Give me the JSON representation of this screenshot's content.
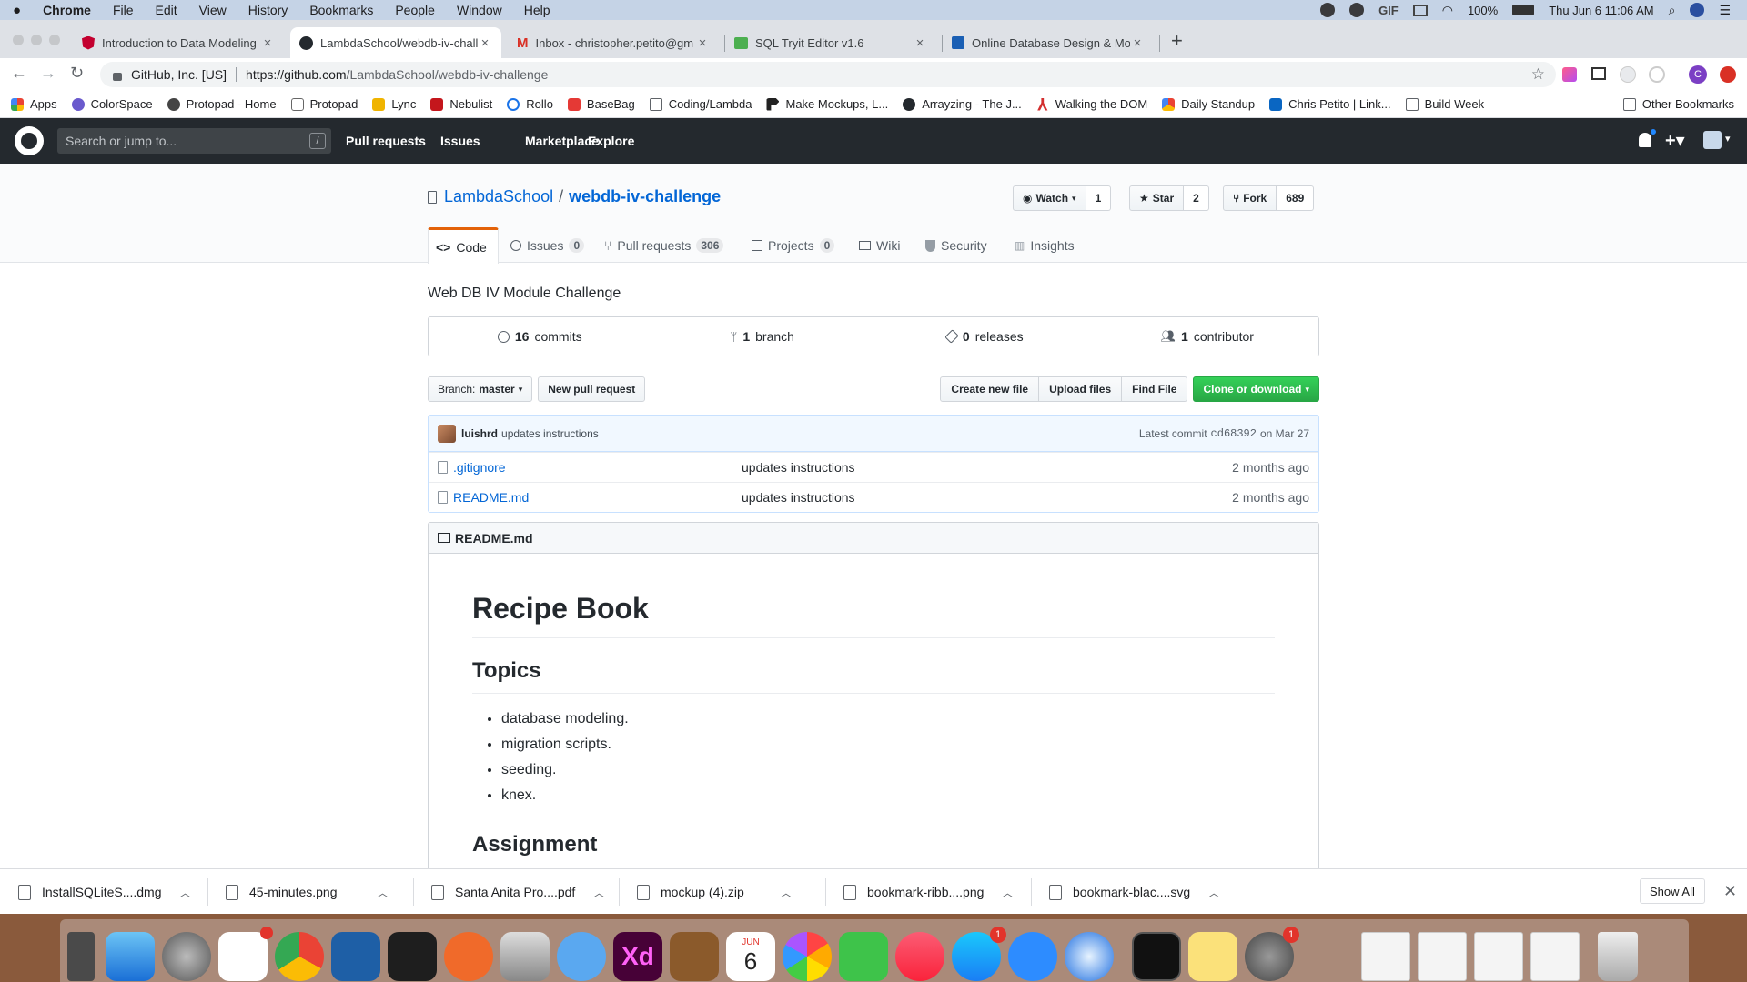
{
  "menubar": {
    "app": "Chrome",
    "items": [
      "File",
      "Edit",
      "View",
      "History",
      "Bookmarks",
      "People",
      "Window",
      "Help"
    ],
    "battery": "100%",
    "datetime": "Thu Jun 6  11:06 AM"
  },
  "tabs": [
    {
      "title": "Introduction to Data Modeling",
      "active": false
    },
    {
      "title": "LambdaSchool/webdb-iv-chall",
      "active": true
    },
    {
      "title": "Inbox - christopher.petito@gm",
      "active": false
    },
    {
      "title": "SQL Tryit Editor v1.6",
      "active": false
    },
    {
      "title": "Online Database Design & Mod",
      "active": false
    }
  ],
  "addressbar": {
    "site_identity": "GitHub, Inc. [US]",
    "url_prefix": "https://github.com",
    "url_path": "/LambdaSchool/webdb-iv-challenge"
  },
  "bookmarks": [
    "Apps",
    "ColorSpace",
    "Protopad - Home",
    "Protopad",
    "Lync",
    "Nebulist",
    "Rollo",
    "BaseBag",
    "Coding/Lambda",
    "Make Mockups, L...",
    "Arrayzing - The J...",
    "Walking the DOM",
    "Daily Standup",
    "Chris Petito | Link...",
    "Build Week"
  ],
  "bookmarks_other": "Other Bookmarks",
  "github": {
    "search_placeholder": "Search or jump to...",
    "search_key": "/",
    "nav": [
      "Pull requests",
      "Issues",
      "Marketplace",
      "Explore"
    ]
  },
  "repo": {
    "owner": "LambdaSchool",
    "separator": "/",
    "name": "webdb-iv-challenge",
    "watch_label": "Watch",
    "watch_count": "1",
    "star_label": "Star",
    "star_count": "2",
    "fork_label": "Fork",
    "fork_count": "689",
    "tabs": {
      "code": "Code",
      "issues": "Issues",
      "issues_count": "0",
      "pulls": "Pull requests",
      "pulls_count": "306",
      "projects": "Projects",
      "projects_count": "0",
      "wiki": "Wiki",
      "security": "Security",
      "insights": "Insights"
    },
    "description": "Web DB IV Module Challenge",
    "summary": {
      "commits_num": "16",
      "commits_label": "commits",
      "branch_num": "1",
      "branch_label": "branch",
      "releases_num": "0",
      "releases_label": "releases",
      "contrib_num": "1",
      "contrib_label": "contributor"
    },
    "branch_prefix": "Branch:",
    "branch_name": "master",
    "new_pr": "New pull request",
    "create_file": "Create new file",
    "upload_files": "Upload files",
    "find_file": "Find File",
    "clone": "Clone or download",
    "latest_commit": {
      "author": "luishrd",
      "message": "updates instructions",
      "label": "Latest commit",
      "sha": "cd68392",
      "date": "on Mar 27"
    },
    "files": [
      {
        "name": ".gitignore",
        "message": "updates instructions",
        "age": "2 months ago"
      },
      {
        "name": "README.md",
        "message": "updates instructions",
        "age": "2 months ago"
      }
    ],
    "readme": {
      "filename": "README.md",
      "h1": "Recipe Book",
      "h2_topics": "Topics",
      "topics": [
        "database modeling.",
        "migration scripts.",
        "seeding.",
        "knex."
      ],
      "h2_assignment": "Assignment"
    }
  },
  "downloads": {
    "items": [
      "InstallSQLiteS....dmg",
      "45-minutes.png",
      "Santa Anita Pro....pdf",
      "mockup (4).zip",
      "bookmark-ribb....png",
      "bookmark-blac....svg"
    ],
    "show_all": "Show All"
  },
  "dock": {
    "badges": {
      "slack": "",
      "appstore": "1",
      "settings": "1"
    },
    "calendar_month": "JUN",
    "calendar_day": "6"
  },
  "colors": {
    "github_header": "#24292e",
    "link": "#0366d6",
    "green_button": "#28a745",
    "active_tab_accent": "#e36209"
  }
}
